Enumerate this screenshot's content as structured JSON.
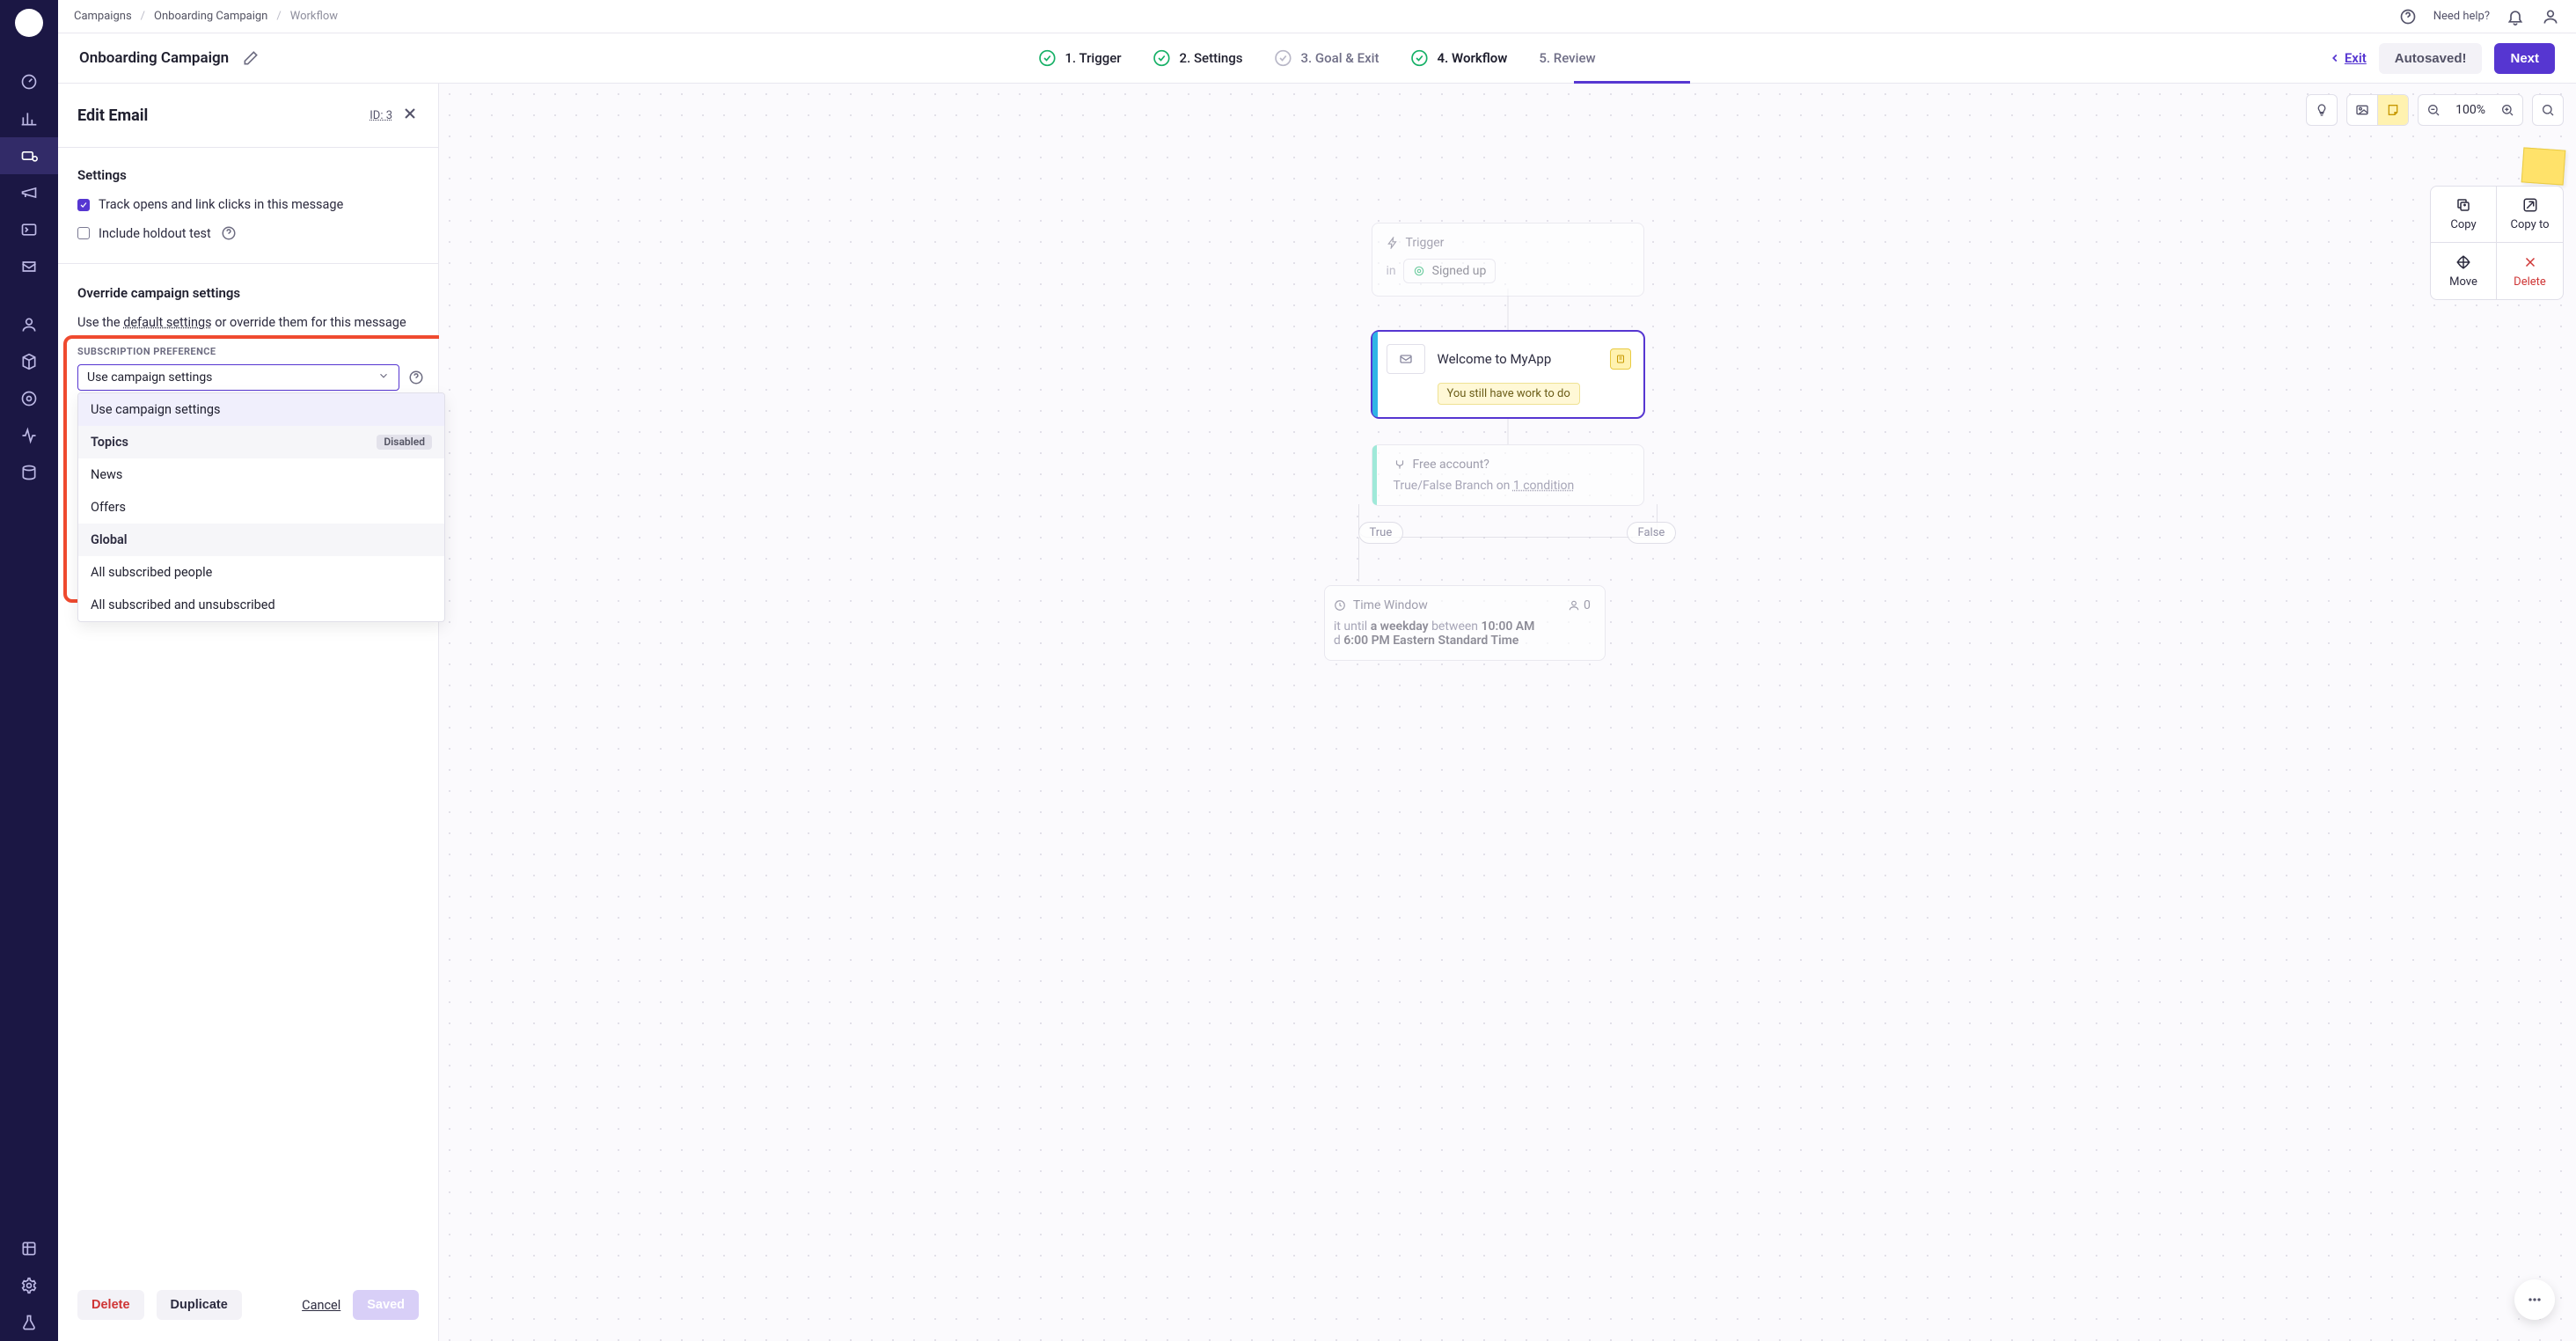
{
  "breadcrumb": {
    "a": "Campaigns",
    "b": "Onboarding Campaign",
    "c": "Workflow"
  },
  "topright": {
    "help": "Need help?"
  },
  "campaign": {
    "title": "Onboarding Campaign"
  },
  "steps": {
    "s1": "1. Trigger",
    "s2": "2. Settings",
    "s3": "3. Goal & Exit",
    "s4": "4. Workflow",
    "s5": "5. Review"
  },
  "stepbar": {
    "exit": "Exit",
    "autosaved": "Autosaved!",
    "next": "Next"
  },
  "sidepanel": {
    "title": "Edit Email",
    "id": "ID: 3",
    "settings_heading": "Settings",
    "track": "Track opens and link clicks in this message",
    "holdout": "Include holdout test",
    "override_heading": "Override campaign settings",
    "override_text_a": "Use the ",
    "override_text_b": "default settings",
    "override_text_c": " or override them for this message",
    "subpref_label": "SUBSCRIPTION PREFERENCE",
    "select_value": "Use campaign settings",
    "options": {
      "o1": "Use campaign settings",
      "g_topics": "Topics",
      "g_topics_badge": "Disabled",
      "o2": "News",
      "o3": "Offers",
      "g_global": "Global",
      "o4": "All subscribed people",
      "o5": "All subscribed and unsubscribed"
    },
    "footer": {
      "delete": "Delete",
      "duplicate": "Duplicate",
      "cancel": "Cancel",
      "saved": "Saved"
    }
  },
  "canvas": {
    "zoom": "100%",
    "actions": {
      "copy": "Copy",
      "copyto": "Copy to",
      "move": "Move",
      "delete": "Delete"
    },
    "trigger": {
      "label": "Trigger",
      "in": "in",
      "event": "Signed up"
    },
    "email": {
      "title": "Welcome to MyApp",
      "note": "You still have work to do"
    },
    "branch": {
      "title": "Free account?",
      "sub_a": "True/False Branch on ",
      "sub_b": "1 condition"
    },
    "tf": {
      "t": "True",
      "f": "False"
    },
    "time": {
      "title": "Time Window",
      "count": "0",
      "wait_a": "it until ",
      "wait_b": "a weekday",
      "wait_c": " between ",
      "wait_d": "10:00 AM",
      "wait_e": "d ",
      "wait_f": "6:00 PM Eastern Standard Time"
    }
  }
}
